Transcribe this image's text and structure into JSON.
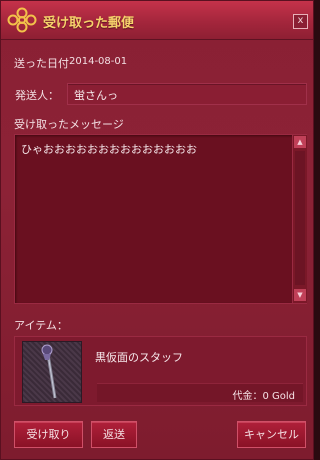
{
  "window": {
    "title": "受け取った郵便",
    "close_label": "x"
  },
  "sent_date": {
    "label": "送った日付",
    "value": "2014-08-01"
  },
  "sender": {
    "label": "発送人：",
    "value": "蛍さんっ"
  },
  "message": {
    "label": "受け取ったメッセージ",
    "text": "ひゃおおおおおおおおおおおおおお"
  },
  "item": {
    "label": "アイテム：",
    "name": "黒仮面のスタッフ",
    "price": "代金：0 Gold"
  },
  "buttons": {
    "receive": "受け取り",
    "return": "返送",
    "cancel": "キャンセル"
  },
  "icons": {
    "logo": "emblem-icon",
    "scroll_up": "▲",
    "scroll_down": "▼"
  },
  "colors": {
    "accent": "#f7d36b",
    "frame": "#8a2034"
  }
}
